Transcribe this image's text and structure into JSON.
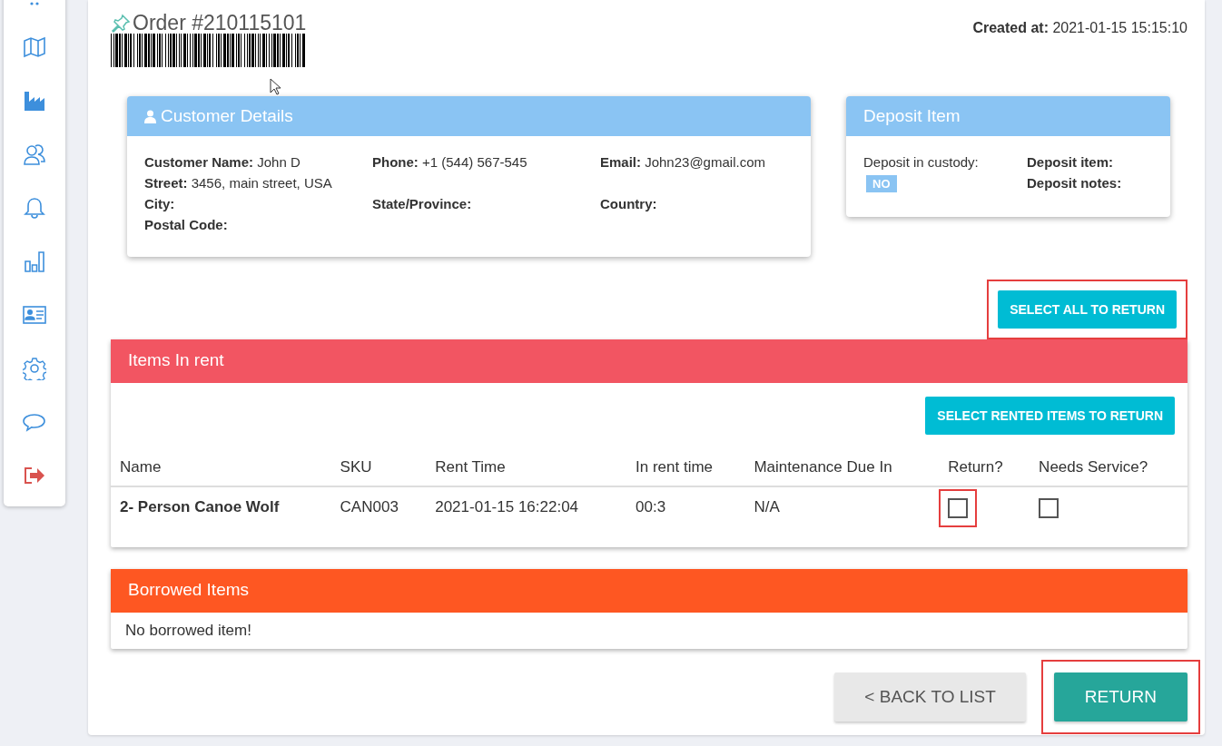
{
  "sidebar": {
    "items": [
      {
        "kind": "map"
      },
      {
        "kind": "factory"
      },
      {
        "kind": "users"
      },
      {
        "kind": "bell"
      },
      {
        "kind": "chart"
      },
      {
        "kind": "card"
      },
      {
        "kind": "gear"
      },
      {
        "kind": "chat"
      },
      {
        "kind": "logout"
      }
    ]
  },
  "order": {
    "title": "Order #210115101",
    "created_label": "Created at:",
    "created_value": "2021-01-15 15:15:10"
  },
  "customer": {
    "title": "Customer Details",
    "rows": [
      [
        {
          "label": "Customer Name:",
          "value": "John D"
        },
        {
          "label": "Phone:",
          "value": "+1 (544) 567-545"
        },
        {
          "label": "Email:",
          "value": "John23@gmail.com"
        }
      ],
      [
        {
          "label": "Street:",
          "value": "3456, main street, USA"
        }
      ],
      [
        {
          "label": "City:"
        },
        {
          "label": "State/Province:"
        },
        {
          "label": "Country:"
        }
      ],
      [
        {
          "label": "Postal Code:"
        }
      ]
    ]
  },
  "deposit": {
    "title": "Deposit Item",
    "custody_label": "Deposit in custody:",
    "custody_badge": "NO",
    "item_label": "Deposit item:",
    "notes_label": "Deposit notes:"
  },
  "select_all_button": {
    "label": "SELECT ALL TO RETURN",
    "highlighted": true
  },
  "items_in_rent": {
    "title": "Items In rent",
    "select_button": {
      "label": "SELECT RENTED ITEMS TO RETURN",
      "highlighted": false
    },
    "columns": [
      "Name",
      "SKU",
      "Rent Time",
      "In rent time",
      "Maintenance Due In",
      "Return?",
      "Needs Service?"
    ],
    "rows": [
      {
        "name": "2- Person Canoe Wolf",
        "sku": "CAN003",
        "rent_time": "2021-01-15 16:22:04",
        "in_rent_time": "00:3",
        "maintenance_due": "N/A",
        "return_checked": false,
        "return_highlighted": true,
        "service_checked": false
      }
    ]
  },
  "borrowed_items": {
    "title": "Borrowed Items",
    "message": "No borrowed item!"
  },
  "buttons": [
    {
      "label": "< BACK TO LIST",
      "kind": "secondary",
      "highlighted": false
    },
    {
      "label": "RETURN",
      "kind": "primary",
      "highlighted": true
    }
  ]
}
